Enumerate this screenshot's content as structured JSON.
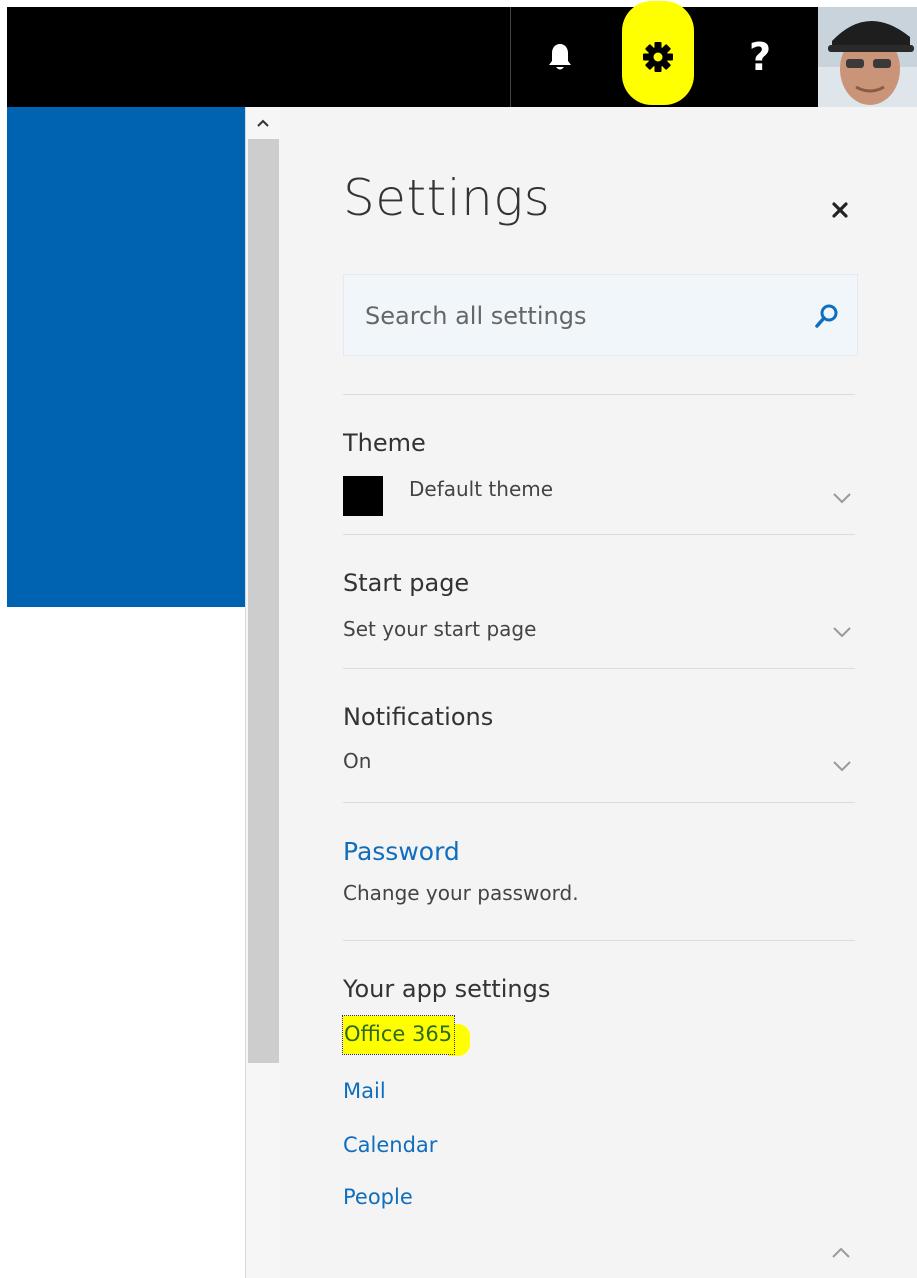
{
  "topbar": {
    "icons": [
      "bell-icon",
      "gear-icon",
      "help-icon",
      "avatar"
    ],
    "help_label": "?",
    "highlight_color": "#ffff00"
  },
  "colors": {
    "accent_blue": "#0063b1",
    "link_blue": "#106ebe",
    "panel_bg": "#f4f4f4"
  },
  "settings": {
    "title": "Settings",
    "search_placeholder": "Search all settings",
    "theme": {
      "title": "Theme",
      "value": "Default theme",
      "swatch_color": "#000000"
    },
    "start_page": {
      "title": "Start page",
      "value": "Set your start page"
    },
    "notifications": {
      "title": "Notifications",
      "value": "On"
    },
    "password": {
      "title": "Password",
      "value": "Change your password."
    },
    "app_settings": {
      "title": "Your app settings",
      "items": [
        "Office 365",
        "Mail",
        "Calendar",
        "People"
      ]
    }
  }
}
